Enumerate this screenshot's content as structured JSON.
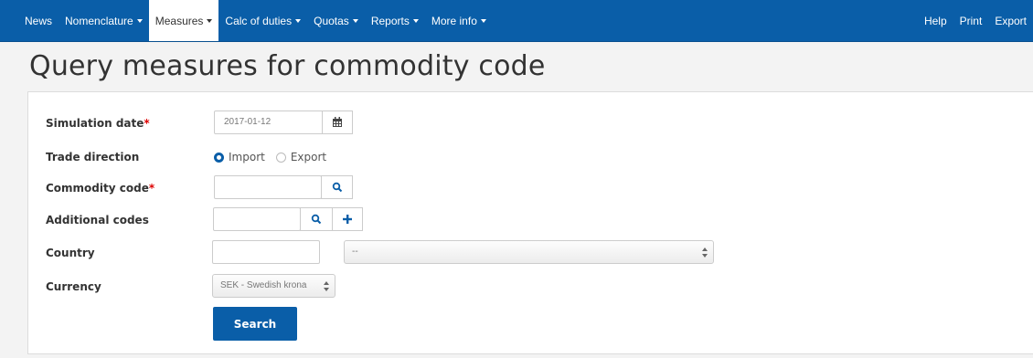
{
  "nav": {
    "left": [
      {
        "label": "News",
        "caret": false
      },
      {
        "label": "Nomenclature",
        "caret": true
      },
      {
        "label": "Measures",
        "caret": true,
        "active": true
      },
      {
        "label": "Calc of duties",
        "caret": true
      },
      {
        "label": "Quotas",
        "caret": true
      },
      {
        "label": "Reports",
        "caret": true
      },
      {
        "label": "More info",
        "caret": true
      }
    ],
    "right": [
      "Help",
      "Print",
      "Export"
    ]
  },
  "page_title": "Query measures for commodity code",
  "form": {
    "simulation_date_label": "Simulation date",
    "simulation_date_value": "2017-01-12",
    "trade_direction_label": "Trade direction",
    "import_label": "Import",
    "export_label": "Export",
    "trade_direction_selected": "Import",
    "commodity_code_label": "Commodity code",
    "additional_codes_label": "Additional codes",
    "country_label": "Country",
    "country_select_value": "--",
    "currency_label": "Currency",
    "currency_value": "SEK - Swedish krona",
    "required_mark": "*",
    "search_button": "Search"
  },
  "icons": {
    "date": "calendar-icon",
    "search": "magnifier-icon",
    "add": "plus-icon"
  },
  "colors": {
    "primary": "#0a5ea8",
    "required": "#dd0000"
  }
}
